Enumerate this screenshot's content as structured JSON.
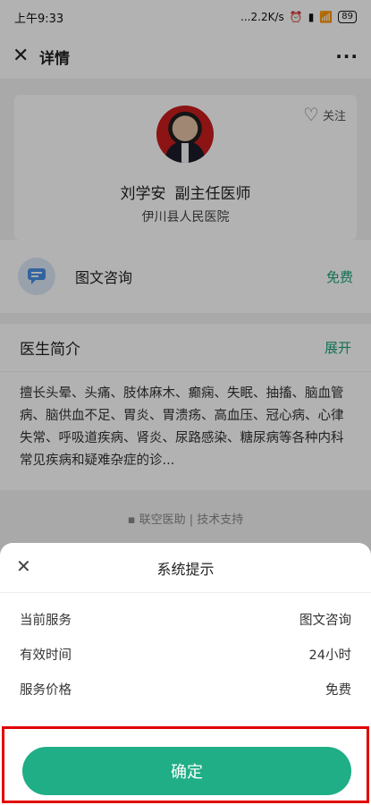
{
  "status_bar": {
    "time": "上午9:33",
    "speed": "...2.2K/s",
    "battery": "89"
  },
  "nav": {
    "title": "详情"
  },
  "doctor": {
    "follow_label": "关注",
    "name": "刘学安",
    "rank": "副主任医师",
    "hospital": "伊川县人民医院"
  },
  "service": {
    "label": "图文咨询",
    "price": "免费"
  },
  "intro": {
    "title": "医生简介",
    "expand_label": "展开",
    "text": "擅长头晕、头痛、肢体麻木、癫痫、失眠、抽搐、脑血管病、脑供血不足、胃炎、胃溃疡、高血压、冠心病、心律失常、呼吸道疾病、肾炎、尿路感染、糖尿病等各种内科常见疾病和疑难杂症的诊..."
  },
  "support": "联空医助 | 技术支持",
  "sheet": {
    "title": "系统提示",
    "rows": [
      {
        "label": "当前服务",
        "value": "图文咨询"
      },
      {
        "label": "有效时间",
        "value": "24小时"
      },
      {
        "label": "服务价格",
        "value": "免费"
      }
    ],
    "confirm_label": "确定"
  },
  "colors": {
    "accent": "#1fae86",
    "highlight_border": "#e10000"
  }
}
